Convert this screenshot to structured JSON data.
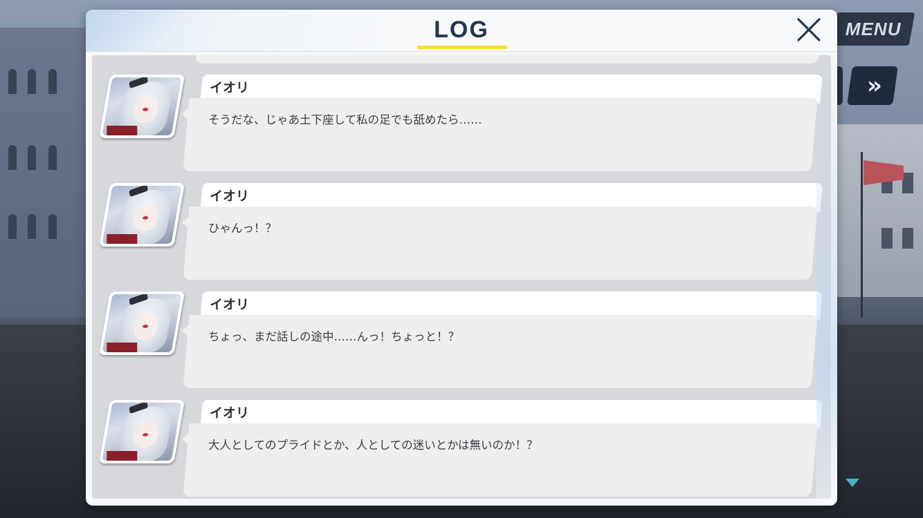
{
  "hud": {
    "menu_label": "MENU",
    "skip_label": "»"
  },
  "log": {
    "title": "LOG",
    "close_glyph": "✕",
    "entries": [
      {
        "speaker": "イオリ",
        "text": "そうだな、じゃあ土下座して私の足でも舐めたら……"
      },
      {
        "speaker": "イオリ",
        "text": "ひゃんっ！？"
      },
      {
        "speaker": "イオリ",
        "text": "ちょっ、まだ話しの途中……んっ！ちょっと！？"
      },
      {
        "speaker": "イオリ",
        "text": "大人としてのプライドとか、人としての迷いとかは無いのか！？"
      }
    ]
  },
  "colors": {
    "title": "#24344d",
    "underline": "#f6e22a",
    "indicator": "#3fb5c2"
  }
}
